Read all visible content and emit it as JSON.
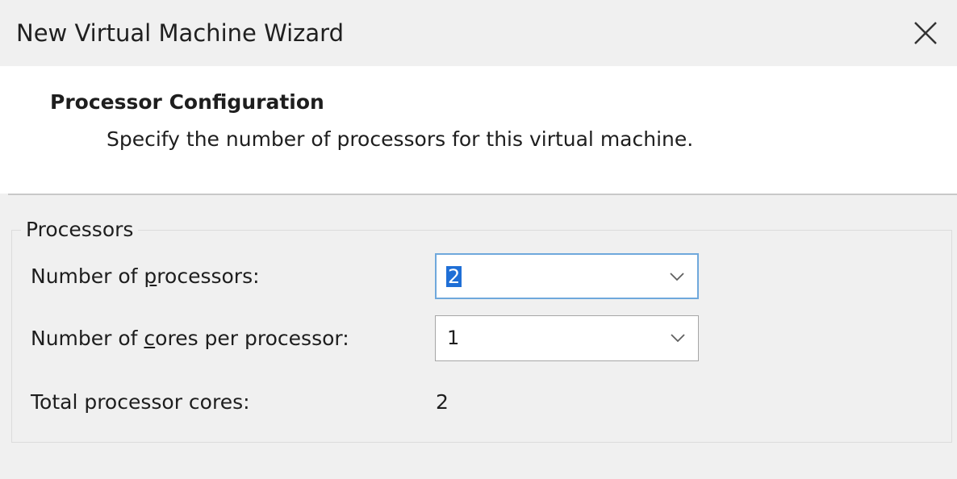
{
  "window": {
    "title": "New Virtual Machine Wizard"
  },
  "header": {
    "title": "Processor Configuration",
    "subtitle": "Specify the number of processors for this virtual machine."
  },
  "processors_group": {
    "legend": "Processors",
    "num_processors": {
      "label_prefix": "Number of ",
      "label_mnemonic": "p",
      "label_suffix": "rocessors:",
      "value": "2"
    },
    "cores_per_processor": {
      "label_prefix": "Number of ",
      "label_mnemonic": "c",
      "label_suffix": "ores per processor:",
      "value": "1"
    },
    "total_cores": {
      "label": "Total processor cores:",
      "value": "2"
    }
  },
  "icons": {
    "close": "close-icon",
    "dropdown": "chevron-down-icon"
  },
  "colors": {
    "selection": "#1f6fd6",
    "focus_border": "#6fa8dc",
    "window_bg": "#f0f0f0",
    "header_bg": "#ffffff"
  }
}
